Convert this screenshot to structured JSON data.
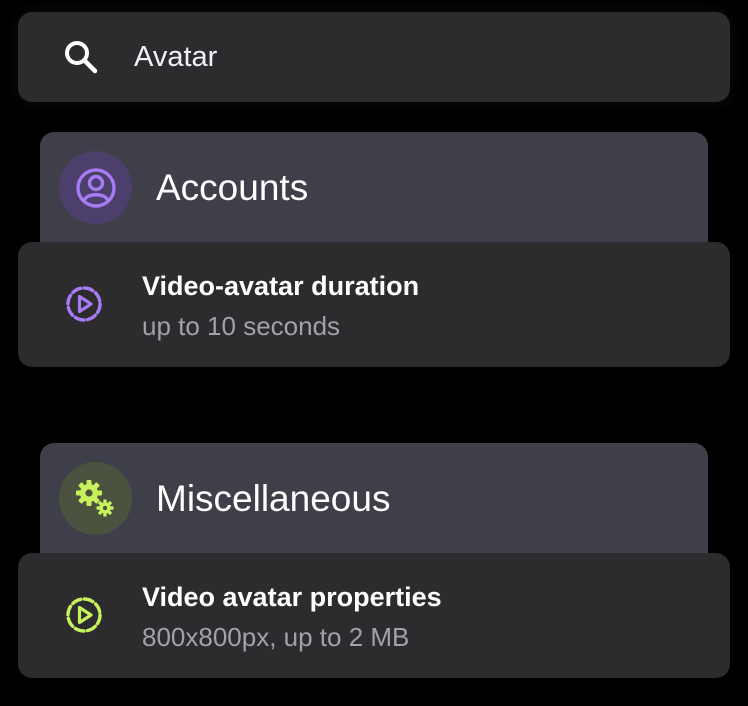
{
  "search": {
    "value": "Avatar",
    "icon": "search-icon"
  },
  "groups": [
    {
      "title": "Accounts",
      "icon": "user-circle-icon",
      "icon_color": "#a77bf3",
      "icon_bg": "#4c3f6b",
      "results": [
        {
          "title": "Video-avatar duration",
          "subtitle": "up to 10 seconds",
          "icon": "play-circle-dashed-icon",
          "icon_color": "#a77bf3"
        }
      ]
    },
    {
      "title": "Miscellaneous",
      "icon": "gears-icon",
      "icon_color": "#c8f25b",
      "icon_bg": "#4b5240",
      "results": [
        {
          "title": "Video avatar properties",
          "subtitle": "800x800px, up to 2 MB",
          "icon": "play-circle-dashed-icon",
          "icon_color": "#c8f25b"
        }
      ]
    }
  ],
  "colors": {
    "background": "#000000",
    "card": "#2c2c2e",
    "group_header": "#3f3f49"
  }
}
